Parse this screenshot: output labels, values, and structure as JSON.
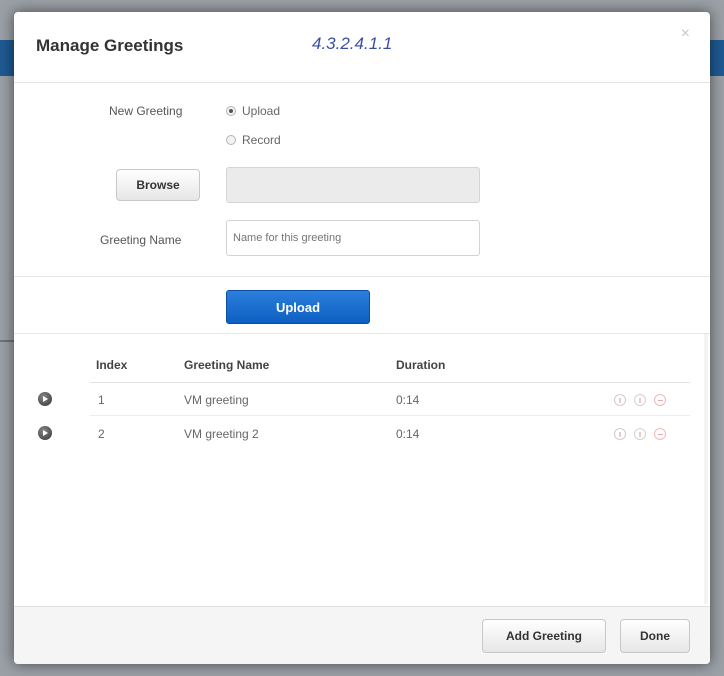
{
  "modal": {
    "title": "Manage Greetings",
    "version_label": "4.3.2.4.1.1",
    "close_glyph": "×"
  },
  "form": {
    "new_greeting_label": "New Greeting",
    "options": [
      {
        "label": "Upload",
        "checked": true
      },
      {
        "label": "Record",
        "checked": false
      }
    ],
    "browse_label": "Browse",
    "greeting_name_label": "Greeting Name",
    "greeting_name_placeholder": "Name for this greeting",
    "greeting_name_value": "",
    "upload_label": "Upload"
  },
  "table": {
    "columns": [
      "Index",
      "Greeting Name",
      "Duration"
    ],
    "rows": [
      {
        "index": "1",
        "name": "VM greeting",
        "duration": "0:14"
      },
      {
        "index": "2",
        "name": "VM greeting 2",
        "duration": "0:14"
      }
    ],
    "row_actions": [
      "download-icon",
      "edit-icon",
      "delete-icon"
    ]
  },
  "footer": {
    "add_greeting_label": "Add Greeting",
    "done_label": "Done"
  },
  "colors": {
    "primary_button": "#0d5fc2",
    "version_text": "#3a4fa2"
  }
}
